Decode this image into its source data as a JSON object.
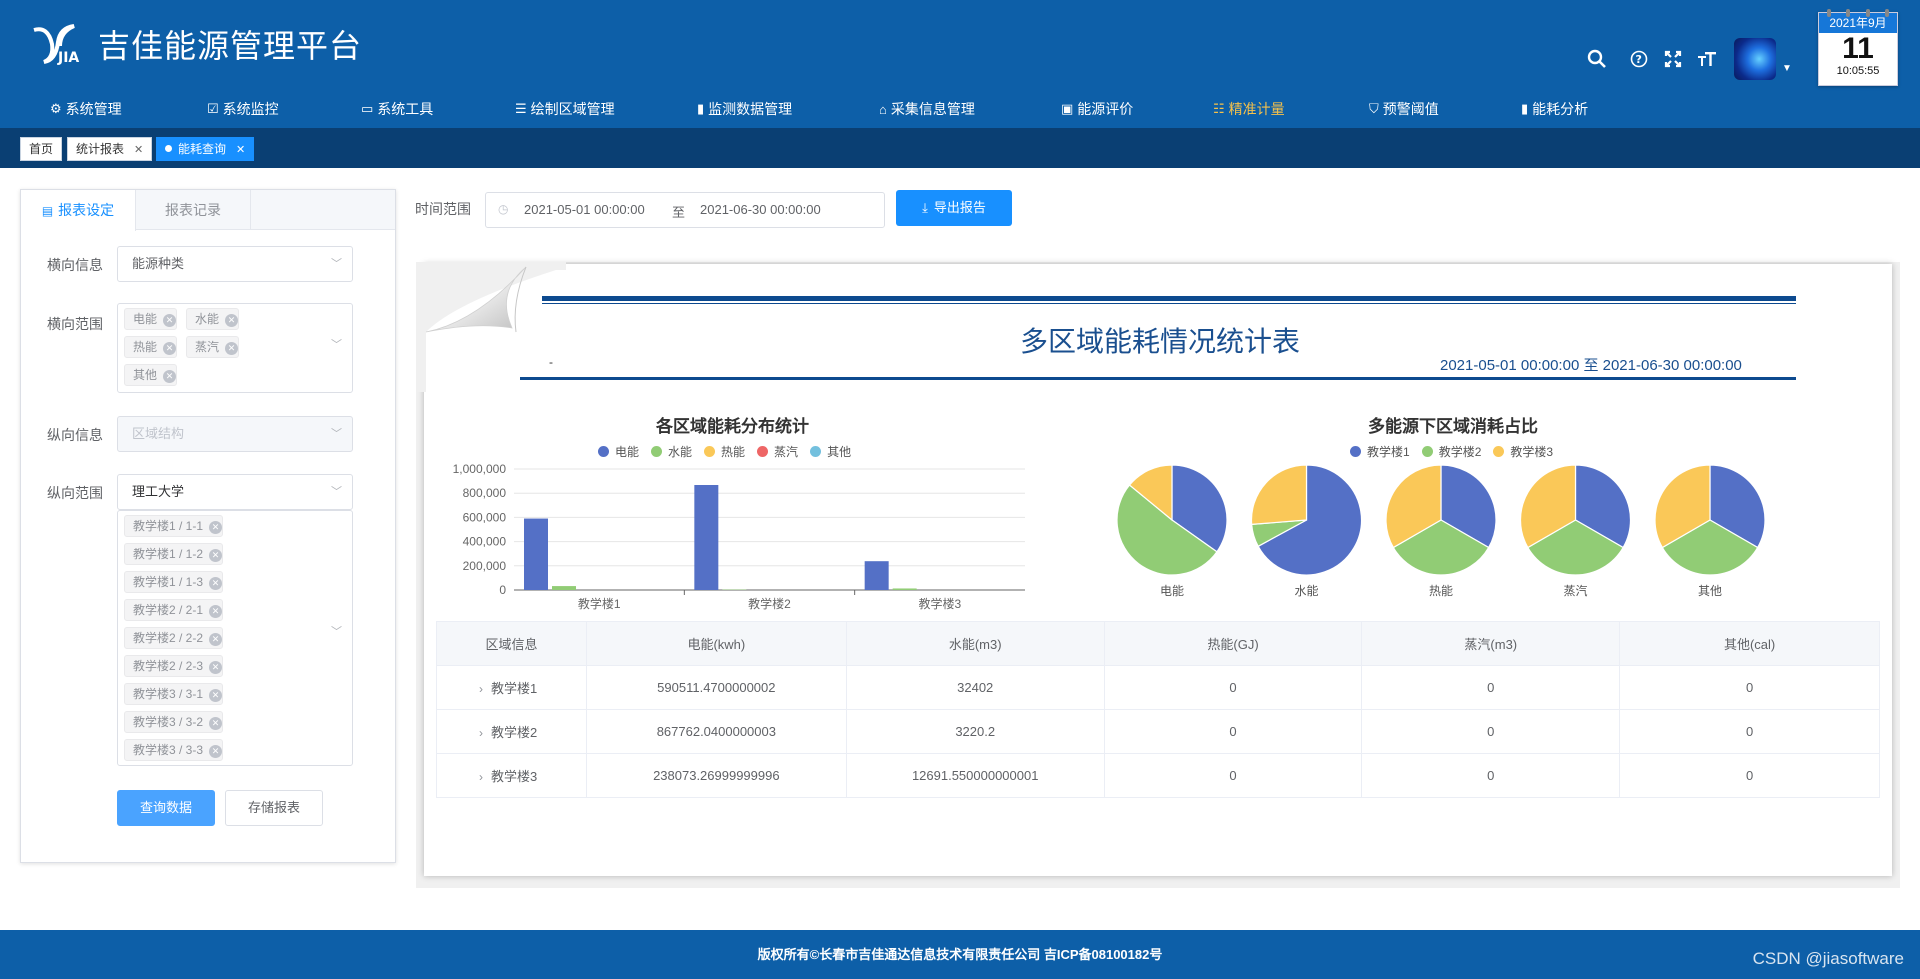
{
  "app": {
    "title": "吉佳能源管理平台",
    "logo_text": "JIA"
  },
  "calendar": {
    "month": "2021年9月",
    "day": "11",
    "time": "10:05:55"
  },
  "nav": [
    {
      "label": "系统管理",
      "icon": "gear-icon"
    },
    {
      "label": "系统监控",
      "icon": "monitor-check-icon"
    },
    {
      "label": "系统工具",
      "icon": "toolbox-icon"
    },
    {
      "label": "绘制区域管理",
      "icon": "list-icon"
    },
    {
      "label": "监测数据管理",
      "icon": "bar-chart-icon"
    },
    {
      "label": "采集信息管理",
      "icon": "collect-icon"
    },
    {
      "label": "能源评价",
      "icon": "monitor-icon"
    },
    {
      "label": "精准计量",
      "icon": "sliders-icon",
      "active": true
    },
    {
      "label": "预警阈值",
      "icon": "shield-icon"
    },
    {
      "label": "能耗分析",
      "icon": "bar-chart-icon"
    }
  ],
  "tabs": [
    {
      "label": "首页"
    },
    {
      "label": "统计报表"
    },
    {
      "label": "能耗查询",
      "active": true
    }
  ],
  "panel": {
    "tabs": [
      "报表设定",
      "报表记录"
    ],
    "horizontal_info_label": "横向信息",
    "horizontal_info_value": "能源种类",
    "horizontal_range_label": "横向范围",
    "horizontal_range_tags": [
      "电能",
      "水能",
      "热能",
      "蒸汽",
      "其他"
    ],
    "vertical_info_label": "纵向信息",
    "vertical_info_placeholder": "区域结构",
    "vertical_range_label": "纵向范围",
    "vertical_range_value": "理工大学",
    "vertical_range_tags": [
      "教学楼1 / 1-1",
      "教学楼1 / 1-2",
      "教学楼1 / 1-3",
      "教学楼2 / 2-1",
      "教学楼2 / 2-2",
      "教学楼2 / 2-3",
      "教学楼3 / 3-1",
      "教学楼3 / 3-2",
      "教学楼3 / 3-3"
    ],
    "query_button": "查询数据",
    "save_button": "存储报表"
  },
  "filter": {
    "label": "时间范围",
    "start": "2021-05-01 00:00:00",
    "separator": "至",
    "end": "2021-06-30 00:00:00",
    "export_button": "导出报告"
  },
  "report": {
    "title": "多区域能耗情况统计表",
    "range": "2021-05-01 00:00:00 至 2021-06-30 00:00:00",
    "corner_mark": "-"
  },
  "colors": {
    "电能": "#5470c6",
    "水能": "#91cc75",
    "热能": "#fac858",
    "蒸汽": "#ee6666",
    "其他": "#73c0de",
    "教学楼1": "#5470c6",
    "教学楼2": "#91cc75",
    "教学楼3": "#fac858"
  },
  "chart_data": [
    {
      "type": "bar",
      "title": "各区域能耗分布统计",
      "categories": [
        "教学楼1",
        "教学楼2",
        "教学楼3"
      ],
      "series": [
        {
          "name": "电能",
          "values": [
            590511.47,
            867762.04,
            238073.27
          ]
        },
        {
          "name": "水能",
          "values": [
            32402,
            3220.2,
            12691.55
          ]
        },
        {
          "name": "热能",
          "values": [
            0,
            0,
            0
          ]
        },
        {
          "name": "蒸汽",
          "values": [
            0,
            0,
            0
          ]
        },
        {
          "name": "其他",
          "values": [
            0,
            0,
            0
          ]
        }
      ],
      "yticks": [
        "1,000,000",
        "800,000",
        "600,000",
        "400,000",
        "200,000",
        "0"
      ],
      "ylim": [
        0,
        1000000
      ],
      "legend": "top",
      "grid": true
    },
    {
      "type": "pie",
      "title": "多能源下区域消耗占比",
      "legend_entries": [
        "教学楼1",
        "教学楼2",
        "教学楼3"
      ],
      "pies": [
        {
          "label": "电能",
          "values": [
            590511.47,
            867762.04,
            238073.27
          ]
        },
        {
          "label": "水能",
          "values": [
            32402,
            3220.2,
            12691.55
          ]
        },
        {
          "label": "热能",
          "values": [
            1,
            1,
            1
          ]
        },
        {
          "label": "蒸汽",
          "values": [
            1,
            1,
            1
          ]
        },
        {
          "label": "其他",
          "values": [
            1,
            1,
            1
          ]
        }
      ]
    }
  ],
  "table": {
    "headers": [
      "区域信息",
      "电能(kwh)",
      "水能(m3)",
      "热能(GJ)",
      "蒸汽(m3)",
      "其他(cal)"
    ],
    "rows": [
      [
        "教学楼1",
        "590511.4700000002",
        "32402",
        "0",
        "0",
        "0"
      ],
      [
        "教学楼2",
        "867762.0400000003",
        "3220.2",
        "0",
        "0",
        "0"
      ],
      [
        "教学楼3",
        "238073.26999999996",
        "12691.550000000001",
        "0",
        "0",
        "0"
      ]
    ]
  },
  "footer": {
    "text": "版权所有©长春市吉佳通达信息技术有限责任公司 吉ICP备08100182号"
  },
  "watermark": "CSDN @jiasoftware"
}
